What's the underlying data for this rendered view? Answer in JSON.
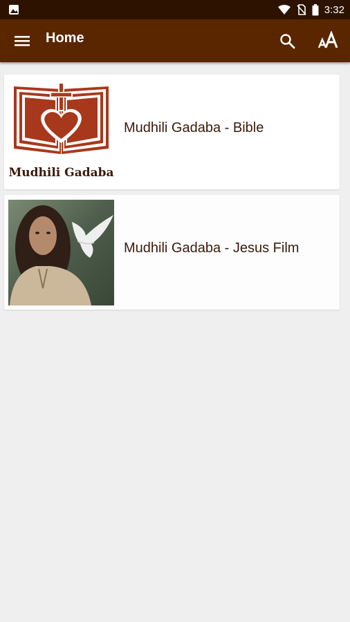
{
  "status_bar": {
    "time": "3:32",
    "colors": {
      "background": "#2d1200"
    },
    "icons": [
      "image-icon",
      "wifi-icon",
      "no-sim-icon",
      "battery-icon"
    ]
  },
  "app_bar": {
    "title": "Home",
    "colors": {
      "background": "#5a2600"
    },
    "icons": [
      "hamburger-menu-icon",
      "search-icon",
      "font-size-icon"
    ]
  },
  "items": [
    {
      "title": "Mudhili Gadaba - Bible",
      "thumbnail_icon": "bible-heart-cross-logo-icon",
      "thumbnail_text": "Mudhili Gadaba"
    },
    {
      "title": "Mudhili Gadaba - Jesus Film",
      "thumbnail_icon": "jesus-with-dove-photo-icon"
    }
  ],
  "colors": {
    "accent": "#a8381c",
    "text": "#3a1a0a",
    "page_background": "#efefef"
  }
}
